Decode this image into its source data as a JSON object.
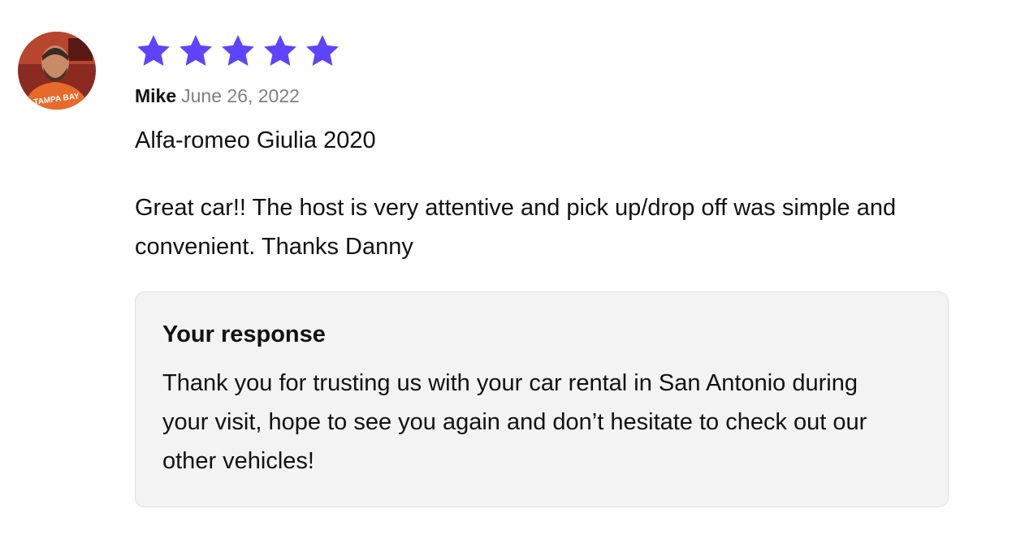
{
  "review": {
    "avatar_icon": "user-avatar-photo",
    "avatar_text": "TAMPA BAY",
    "rating": 5,
    "star_color": "#5e43ff",
    "author": "Mike",
    "date": "June 26, 2022",
    "vehicle": "Alfa-romeo Giulia 2020",
    "text": "Great car!! The host is very attentive and pick up/drop off was simple and convenient. Thanks Danny"
  },
  "response": {
    "title": "Your response",
    "text": "Thank you for trusting us with your car rental in San Antonio during your visit, hope to see you again and don’t hesitate to check out our other vehicles!"
  }
}
